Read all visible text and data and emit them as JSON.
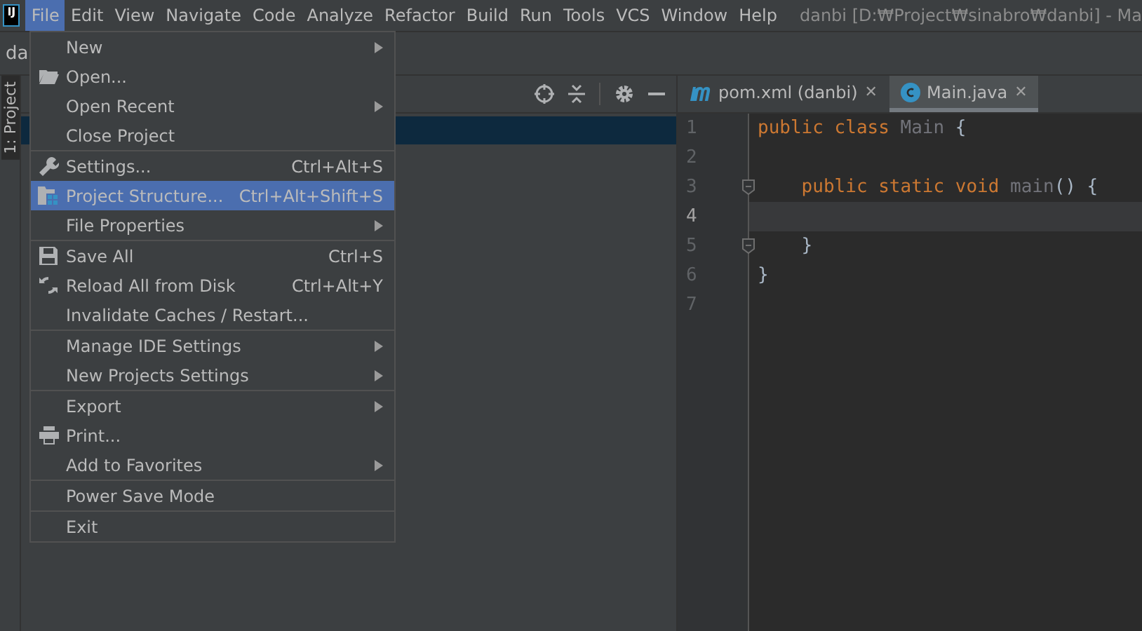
{
  "logo": "IJ",
  "menubar": [
    {
      "label": "File",
      "selected": true
    },
    {
      "label": "Edit",
      "selected": false
    },
    {
      "label": "View",
      "selected": false
    },
    {
      "label": "Navigate",
      "selected": false
    },
    {
      "label": "Code",
      "selected": false
    },
    {
      "label": "Analyze",
      "selected": false
    },
    {
      "label": "Refactor",
      "selected": false
    },
    {
      "label": "Build",
      "selected": false
    },
    {
      "label": "Run",
      "selected": false
    },
    {
      "label": "Tools",
      "selected": false
    },
    {
      "label": "VCS",
      "selected": false
    },
    {
      "label": "Window",
      "selected": false
    },
    {
      "label": "Help",
      "selected": false
    }
  ],
  "window": {
    "title": "danbi [D:₩Project₩sinabro₩danbi] - Ma"
  },
  "breadcrumb": "da",
  "side_tab": {
    "label": "1: Project",
    "selected": true
  },
  "file_menu": [
    [
      {
        "label": "New",
        "submenu": true,
        "selected": false
      },
      {
        "label": "Open...",
        "submenu": false,
        "selected": false
      },
      {
        "label": "Open Recent",
        "submenu": true,
        "selected": false
      },
      {
        "label": "Close Project",
        "submenu": false,
        "selected": false
      }
    ],
    [
      {
        "label": "Settings...",
        "shortcut": "Ctrl+Alt+S",
        "submenu": false,
        "selected": false
      },
      {
        "label": "Project Structure...",
        "shortcut": "Ctrl+Alt+Shift+S",
        "submenu": false,
        "selected": true
      },
      {
        "label": "File Properties",
        "submenu": true,
        "selected": false
      }
    ],
    [
      {
        "label": "Save All",
        "shortcut": "Ctrl+S",
        "submenu": false,
        "selected": false
      },
      {
        "label": "Reload All from Disk",
        "shortcut": "Ctrl+Alt+Y",
        "submenu": false,
        "selected": false
      },
      {
        "label": "Invalidate Caches / Restart...",
        "submenu": false,
        "selected": false
      }
    ],
    [
      {
        "label": "Manage IDE Settings",
        "submenu": true,
        "selected": false
      },
      {
        "label": "New Projects Settings",
        "submenu": true,
        "selected": false
      }
    ],
    [
      {
        "label": "Export",
        "submenu": true,
        "selected": false
      },
      {
        "label": "Print...",
        "submenu": false,
        "selected": false
      },
      {
        "label": "Add to Favorites",
        "submenu": true,
        "selected": false
      }
    ],
    [
      {
        "label": "Power Save Mode",
        "submenu": false,
        "selected": false
      }
    ],
    [
      {
        "label": "Exit",
        "submenu": false,
        "selected": false
      }
    ]
  ],
  "editor_tabs": [
    {
      "label": "pom.xml (danbi)",
      "kind": "maven",
      "close": "✕",
      "selected": false
    },
    {
      "label": "Main.java",
      "kind": "class",
      "close": "✕",
      "selected": true
    }
  ],
  "code": [
    {
      "number": "1",
      "current": false,
      "fold": false,
      "tokens": [
        {
          "text": "public class ",
          "kind": "keyword"
        },
        {
          "text": "Main ",
          "kind": "unused"
        },
        {
          "text": "{",
          "kind": "plain"
        }
      ]
    },
    {
      "number": "2",
      "current": false,
      "fold": false
    },
    {
      "number": "3",
      "current": false,
      "fold": true,
      "tokens": [
        {
          "text": "    public static void ",
          "kind": "keyword"
        },
        {
          "text": "main",
          "kind": "unused"
        },
        {
          "text": "() {",
          "kind": "plain"
        }
      ]
    },
    {
      "number": "4",
      "current": true,
      "fold": false
    },
    {
      "number": "5",
      "current": false,
      "fold": true,
      "tokens": [
        {
          "text": "    }",
          "kind": "plain"
        }
      ]
    },
    {
      "number": "6",
      "current": false,
      "fold": false,
      "tokens": [
        {
          "text": "}",
          "kind": "plain"
        }
      ]
    },
    {
      "number": "7",
      "current": false,
      "fold": false
    }
  ]
}
